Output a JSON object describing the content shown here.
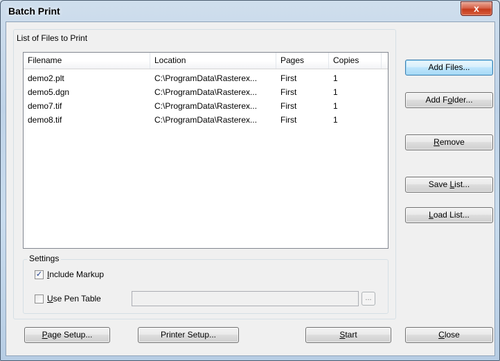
{
  "window": {
    "title": "Batch Print",
    "close_glyph": "x"
  },
  "files_group": {
    "label": "List of Files to Print"
  },
  "list": {
    "columns": [
      "Filename",
      "Location",
      "Pages",
      "Copies"
    ],
    "rows": [
      [
        "demo2.plt",
        "C:\\ProgramData\\Rasterex...",
        "First",
        "1"
      ],
      [
        "demo5.dgn",
        "C:\\ProgramData\\Rasterex...",
        "First",
        "1"
      ],
      [
        "demo7.tif",
        "C:\\ProgramData\\Rasterex...",
        "First",
        "1"
      ],
      [
        "demo8.tif",
        "C:\\ProgramData\\Rasterex...",
        "First",
        "1"
      ]
    ]
  },
  "side_buttons": {
    "add_files": "Add Files...",
    "add_folder_pre": "Add F",
    "add_folder_key": "o",
    "add_folder_post": "lder...",
    "remove_key": "R",
    "remove_post": "emove",
    "save_pre": "Save ",
    "save_key": "L",
    "save_post": "ist...",
    "load_key": "L",
    "load_post": "oad List..."
  },
  "settings": {
    "label": "Settings",
    "include_markup_key": "I",
    "include_markup_post": "nclude Markup",
    "include_markup_checked": true,
    "use_pen_key": "U",
    "use_pen_post": "se Pen Table",
    "use_pen_checked": false,
    "pen_table_value": "",
    "browse_label": "..."
  },
  "bottom_buttons": {
    "page_setup_key": "P",
    "page_setup_post": "age Setup...",
    "printer_setup": "Printer Setup...",
    "start_key": "S",
    "start_post": "tart",
    "close_key": "C",
    "close_post": "lose"
  },
  "colors": {
    "titlebar": "#c9dcee",
    "close": "#c43b1c",
    "dialog_bg": "#f0f0f0"
  }
}
